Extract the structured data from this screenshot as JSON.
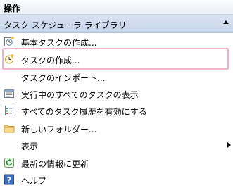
{
  "header": {
    "title": "操作"
  },
  "section": {
    "title": "タスク スケジューラ ライブラリ"
  },
  "items": [
    {
      "label": "基本タスクの作成...",
      "icon": "basic-task-icon"
    },
    {
      "label": "タスクの作成...",
      "icon": "create-task-icon"
    },
    {
      "label": "タスクのインポート...",
      "icon": ""
    },
    {
      "label": "実行中のすべてのタスクの表示",
      "icon": "running-tasks-icon"
    },
    {
      "label": "すべてのタスク履歴を有効にする",
      "icon": "history-icon"
    },
    {
      "label": "新しいフォルダー...",
      "icon": "folder-icon"
    },
    {
      "label": "表示",
      "icon": ""
    },
    {
      "label": "最新の情報に更新",
      "icon": "refresh-icon"
    },
    {
      "label": "ヘルプ",
      "icon": "help-icon"
    }
  ]
}
